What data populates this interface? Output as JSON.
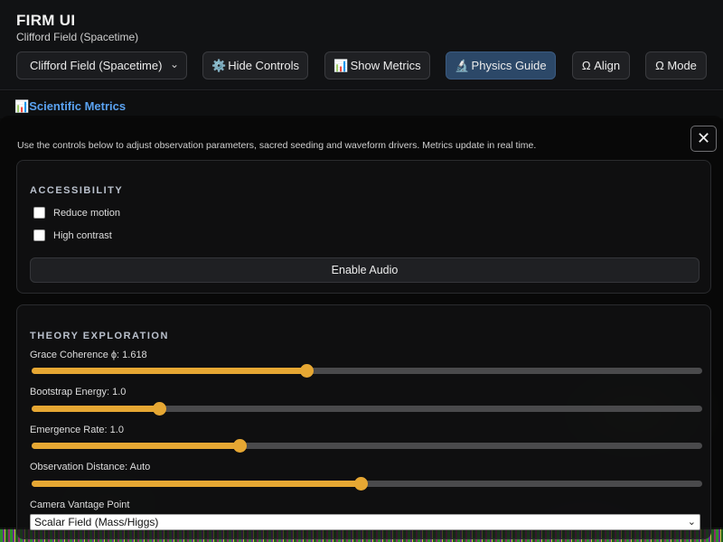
{
  "header": {
    "title": "FIRM UI",
    "subtitle": "Clifford Field (Spacetime)"
  },
  "toolbar": {
    "field_select_value": "Clifford Field (Spacetime)",
    "buttons": [
      {
        "icon": "⚙️",
        "label": "Hide Controls",
        "active": false
      },
      {
        "icon": "📊",
        "label": "Show Metrics",
        "active": false
      },
      {
        "icon": "🔬",
        "label": "Physics Guide",
        "active": true
      },
      {
        "icon": "",
        "label": "Ω Align",
        "active": false
      },
      {
        "icon": "",
        "label": "Ω Mode",
        "active": false
      }
    ]
  },
  "metrics": {
    "icon": "📊",
    "title": "Scientific Metrics"
  },
  "panel": {
    "close_glyph": "✕",
    "intro": "Use the controls below to adjust observation parameters, sacred seeding and waveform drivers. Metrics update in real time."
  },
  "accessibility": {
    "title": "ACCESSIBILITY",
    "options": [
      {
        "label": "Reduce motion",
        "checked": false
      },
      {
        "label": "High contrast",
        "checked": false
      }
    ],
    "audio_button": "Enable Audio"
  },
  "theory": {
    "title": "THEORY EXPLORATION",
    "sliders": [
      {
        "label": "Grace Coherence ϕ: 1.618",
        "value": 0.41
      },
      {
        "label": "Bootstrap Energy: 1.0",
        "value": 0.19
      },
      {
        "label": "Emergence Rate: 1.0",
        "value": 0.31
      },
      {
        "label": "Observation Distance: Auto",
        "value": 0.49
      }
    ],
    "vantage_label": "Camera Vantage Point",
    "vantage_value": "Scalar Field (Mass/Higgs)"
  },
  "colors": {
    "accent": "#e6a733",
    "active_button": "#2c4868",
    "metrics_title": "#5aa2f0"
  }
}
